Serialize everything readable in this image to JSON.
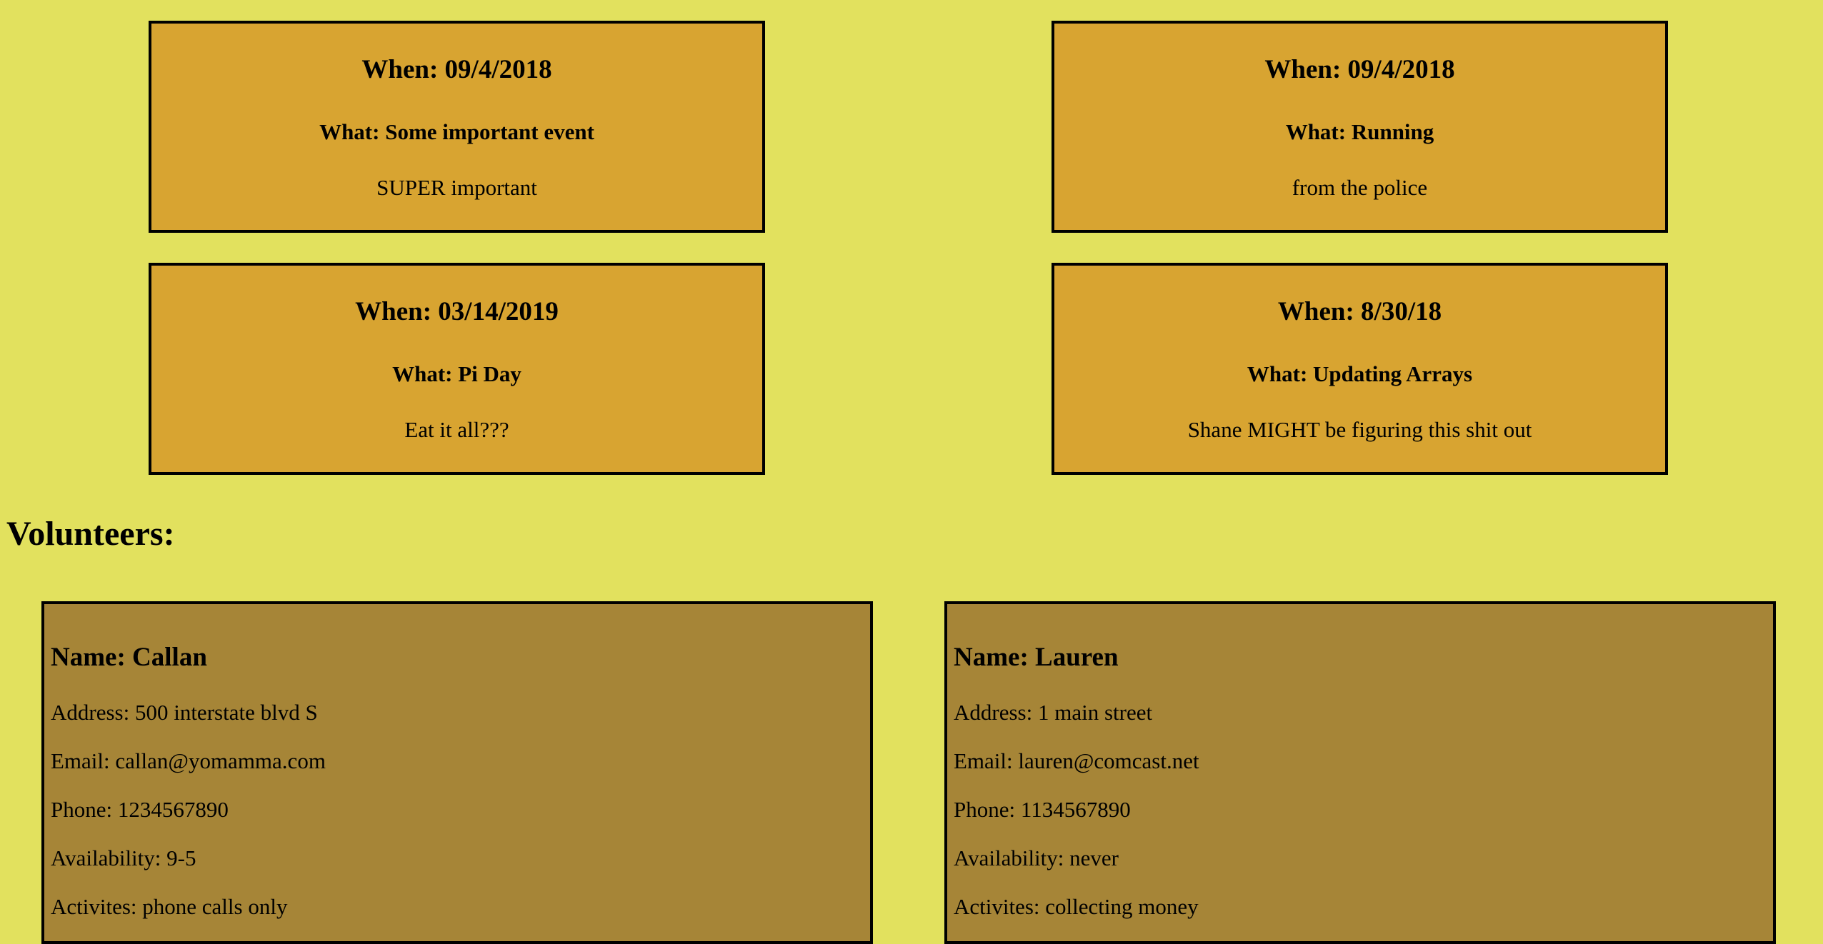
{
  "events": [
    {
      "when": "When: 09/4/2018",
      "what": "What: Some important event",
      "desc": "SUPER important"
    },
    {
      "when": "When: 09/4/2018",
      "what": "What: Running",
      "desc": "from the police"
    },
    {
      "when": "When: 03/14/2019",
      "what": "What: Pi Day",
      "desc": "Eat it all???"
    },
    {
      "when": "When: 8/30/18",
      "what": "What: Updating Arrays",
      "desc": "Shane MIGHT be figuring this shit out"
    }
  ],
  "volunteers_heading": "Volunteers:",
  "volunteers": [
    {
      "name": "Name: Callan",
      "address": "Address: 500 interstate blvd S",
      "email": "Email: callan@yomamma.com",
      "phone": "Phone: 1234567890",
      "availability": "Availability: 9-5",
      "activities": "Activites: phone calls only"
    },
    {
      "name": "Name: Lauren",
      "address": "Address: 1 main street",
      "email": "Email: lauren@comcast.net",
      "phone": "Phone: 1134567890",
      "availability": "Availability: never",
      "activities": "Activites: collecting money"
    }
  ],
  "colors": {
    "page_background": "#e2e15e",
    "event_card": "#d8a431",
    "volunteer_card": "#a68537",
    "border": "#000000"
  }
}
